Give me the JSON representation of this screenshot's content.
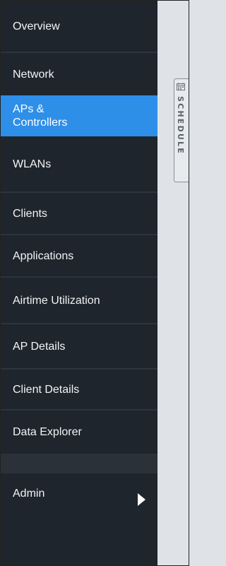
{
  "sidebar": {
    "items": [
      {
        "label": "Overview"
      },
      {
        "label": "Network"
      },
      {
        "label": "APs &\nControllers"
      },
      {
        "label": "WLANs"
      },
      {
        "label": "Clients"
      },
      {
        "label": "Applications"
      },
      {
        "label": "Airtime Utilization"
      },
      {
        "label": "AP Details"
      },
      {
        "label": "Client Details"
      },
      {
        "label": "Data Explorer"
      }
    ],
    "active_index": 2,
    "admin": {
      "label": "Admin",
      "icon": "chevron-right-icon"
    }
  },
  "schedule_tab": {
    "label": "SCHEDULE",
    "icon": "calendar-icon"
  },
  "colors": {
    "sidebar_bg": "#1e252d",
    "active_bg": "#2e8fe8",
    "content_bg": "#dfe3e7",
    "text": "#f2f4f6"
  }
}
